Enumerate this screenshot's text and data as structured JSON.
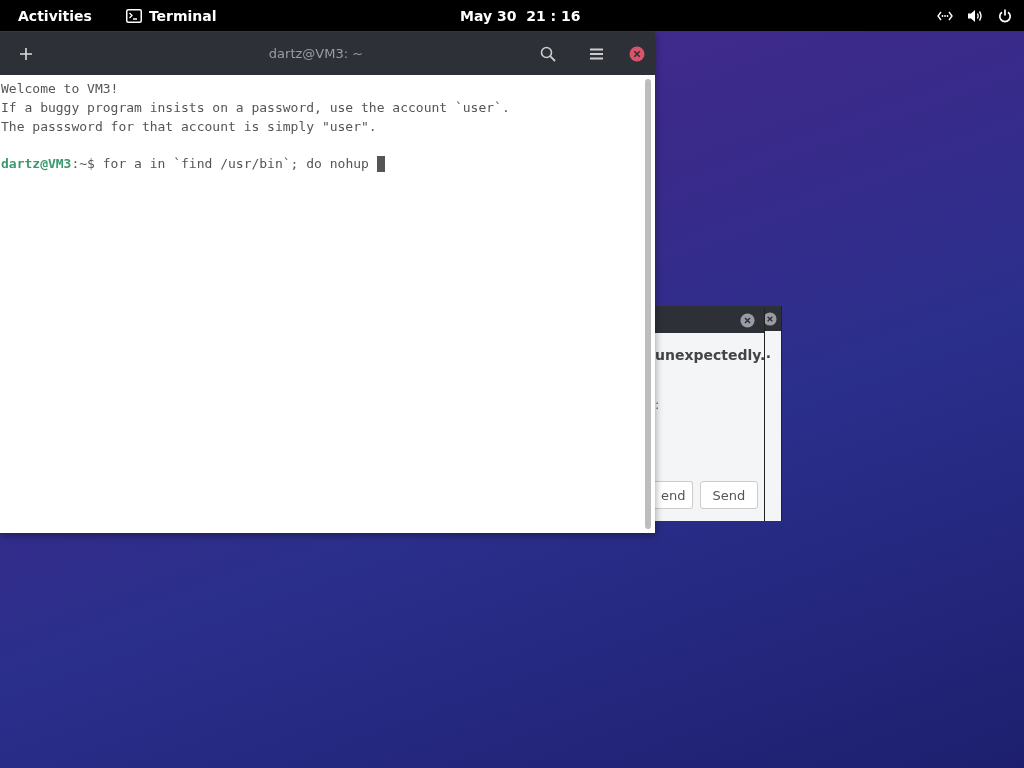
{
  "top_bar": {
    "activities": "Activities",
    "app": {
      "label": "Terminal"
    },
    "clock": "May 30  21 : 16"
  },
  "terminal": {
    "title": "dartz@VM3: ~",
    "lines": [
      "Welcome to VM3!",
      "If a buggy program insists on a password, use the account `user`.",
      "The passsword for that account is simply \"user\"."
    ],
    "prompt": {
      "user_host": "dartz@VM3",
      "suffix": ":~$",
      "command": "for a in `find /usr/bin`; do nohup"
    }
  },
  "dialogs": [
    {
      "message": "unexpectedly.",
      "fragment": ":",
      "buttons": [
        "end",
        "Send"
      ]
    },
    {
      "message": "."
    }
  ]
}
